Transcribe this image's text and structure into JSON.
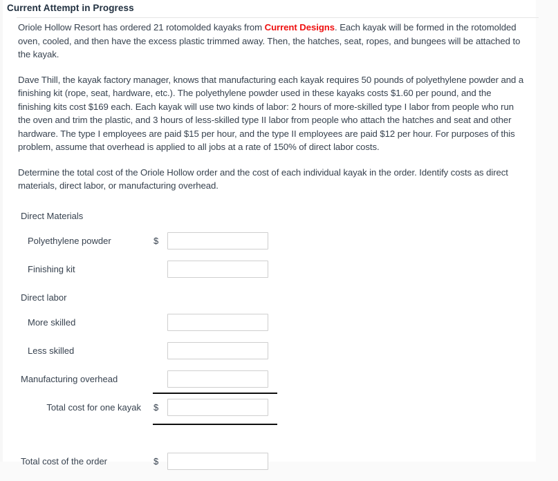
{
  "header": {
    "title": "Current Attempt in Progress"
  },
  "problem": {
    "paragraph1_pre": "Oriole Hollow Resort has ordered 21 rotomolded kayaks from ",
    "paragraph1_brand": "Current Designs",
    "paragraph1_post": ". Each kayak will be formed in the rotomolded oven, cooled, and then have the excess plastic trimmed away. Then, the hatches, seat, ropes, and bungees will be attached to the kayak.",
    "paragraph2": "Dave Thill, the kayak factory manager, knows that manufacturing each kayak requires 50 pounds of polyethylene powder and a finishing kit (rope, seat, hardware, etc.). The polyethylene powder used in these kayaks costs $1.60 per pound, and the finishing kits cost $169 each. Each kayak will use two kinds of labor: 2 hours of more-skilled type I labor from people who run the oven and trim the plastic, and 3 hours of less-skilled type II labor from people who attach the hatches and seat and other hardware. The type I employees are paid $15 per hour, and the type II employees are paid $12 per hour. For purposes of this problem, assume that overhead is applied to all jobs at a rate of 150% of direct labor costs.",
    "paragraph3": "Determine the total cost of the Oriole Hollow order and the cost of each individual kayak in the order. Identify costs as direct materials, direct labor, or manufacturing overhead."
  },
  "form": {
    "direct_materials_heading": "Direct Materials",
    "polyethylene_powder_label": "Polyethylene powder",
    "polyethylene_powder_value": "",
    "polyethylene_powder_currency": "$",
    "finishing_kit_label": "Finishing kit",
    "finishing_kit_value": "",
    "direct_labor_heading": "Direct labor",
    "more_skilled_label": "More skilled",
    "more_skilled_value": "",
    "less_skilled_label": "Less skilled",
    "less_skilled_value": "",
    "manufacturing_overhead_label": "Manufacturing overhead",
    "manufacturing_overhead_value": "",
    "total_cost_one_kayak_label": "Total cost for one kayak",
    "total_cost_one_kayak_value": "",
    "total_cost_one_kayak_currency": "$",
    "total_cost_order_label": "Total cost of the order",
    "total_cost_order_value": "",
    "total_cost_order_currency": "$"
  },
  "colors": {
    "brand_red": "#ee1111",
    "text": "#37424f",
    "panel_bg": "#ffffff",
    "page_bg": "#fafafa",
    "field_border": "#cfcfcf",
    "rule": "#0d0d0d"
  }
}
